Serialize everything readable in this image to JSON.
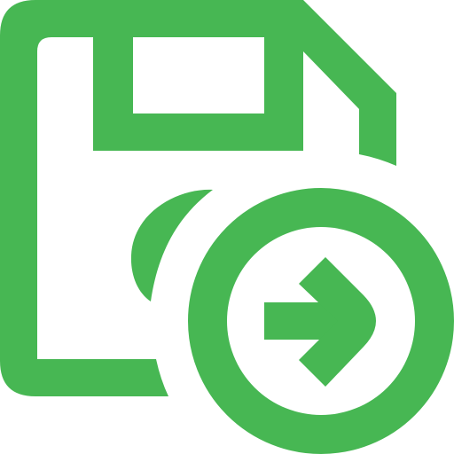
{
  "icon": {
    "name": "save-as-export-icon",
    "color": "#47b753",
    "background": "#ffffff"
  },
  "parts": {
    "floppy": "floppy-disk-icon",
    "arrow_badge": "arrow-right-circle-icon"
  }
}
